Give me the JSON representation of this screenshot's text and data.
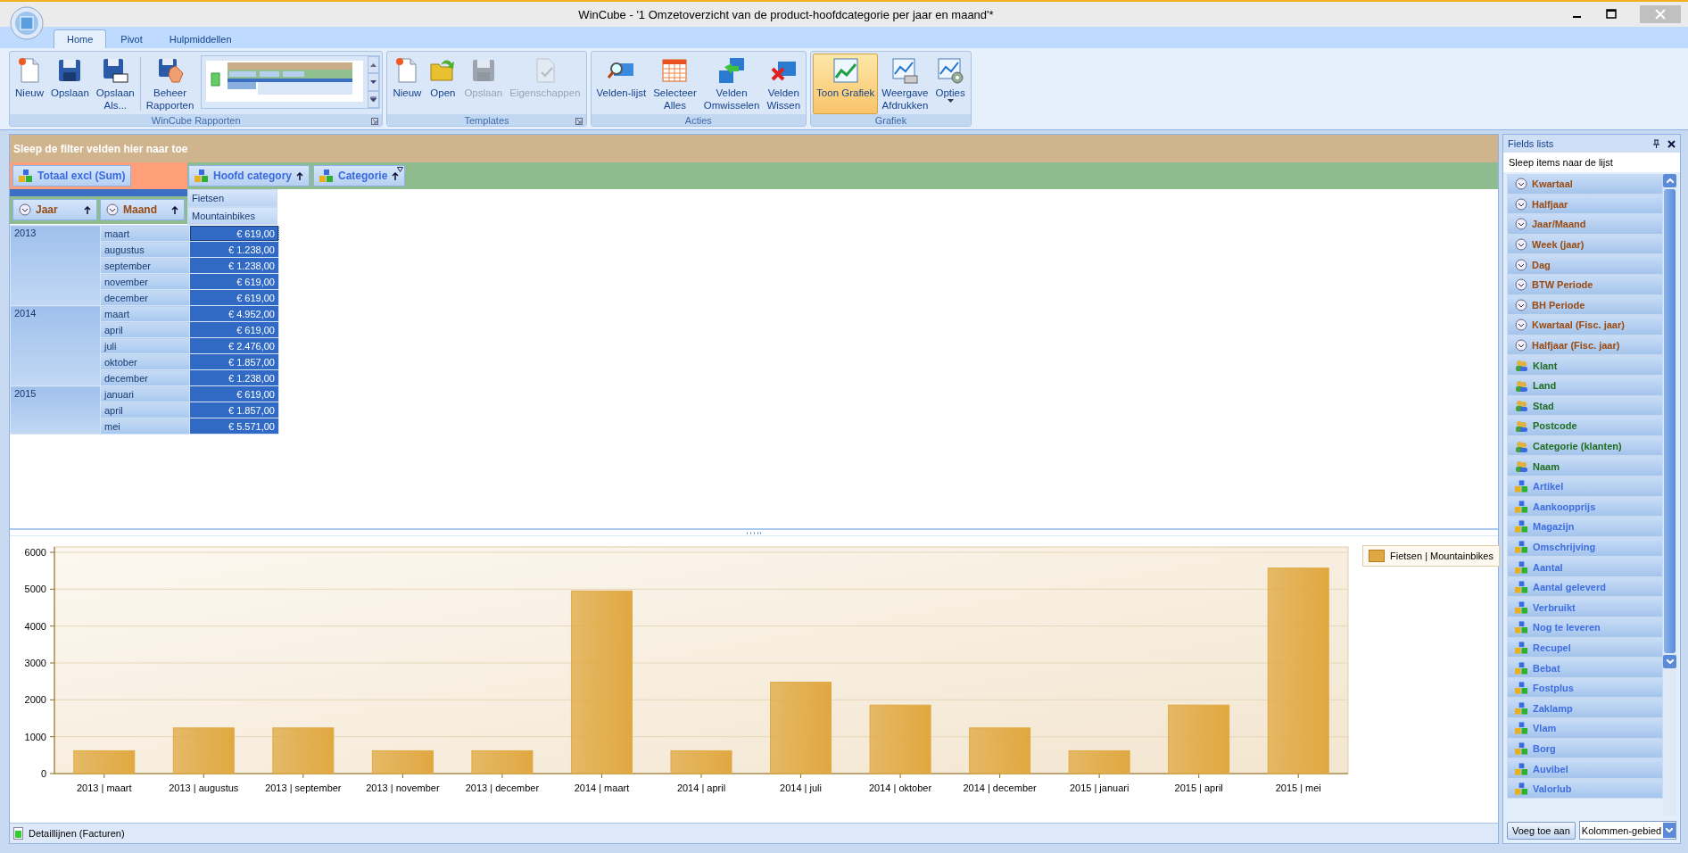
{
  "window": {
    "title": "WinCube - '1 Omzetoverzicht van de product-hoofdcategorie per jaar en maand'*"
  },
  "tabs": [
    {
      "label": "Home",
      "selected": true
    },
    {
      "label": "Pivot",
      "selected": false
    },
    {
      "label": "Hulpmiddellen",
      "selected": false
    }
  ],
  "ribbon_groups": [
    {
      "title": "WinCube Rapporten",
      "launcher": true,
      "buttons": [
        {
          "label": "Nieuw",
          "disabled": false,
          "selected": false
        },
        {
          "label": "Opslaan",
          "disabled": false,
          "selected": false
        },
        {
          "label": "Opslaan\nAls...",
          "disabled": false,
          "selected": false
        },
        {
          "label": "Beheer\nRapporten",
          "disabled": false,
          "selected": false
        }
      ]
    },
    {
      "title": "Templates",
      "launcher": true,
      "buttons": [
        {
          "label": "Nieuw",
          "disabled": false,
          "selected": false
        },
        {
          "label": "Open",
          "disabled": false,
          "selected": false
        },
        {
          "label": "Opslaan",
          "disabled": true,
          "selected": false
        },
        {
          "label": "Eigenschappen",
          "disabled": true,
          "selected": false
        }
      ]
    },
    {
      "title": "Acties",
      "launcher": false,
      "buttons": [
        {
          "label": "Velden-lijst",
          "disabled": false,
          "selected": false
        },
        {
          "label": "Selecteer\nAlles",
          "disabled": false,
          "selected": false
        },
        {
          "label": "Velden\nOmwisselen",
          "disabled": false,
          "selected": false
        },
        {
          "label": "Velden\nWissen",
          "disabled": false,
          "selected": false
        }
      ]
    },
    {
      "title": "Grafiek",
      "launcher": false,
      "buttons": [
        {
          "label": "Toon Grafiek",
          "disabled": false,
          "selected": true
        },
        {
          "label": "Weergave\nAfdrukken",
          "disabled": false,
          "selected": false
        },
        {
          "label": "Opties",
          "disabled": false,
          "selected": false
        }
      ]
    }
  ],
  "pivot": {
    "filter_area": "Sleep de filter velden hier naar toe",
    "data_fields": [
      {
        "label": "Totaal excl (Sum)"
      }
    ],
    "column_fields": [
      {
        "label": "Hoofd category",
        "filter": false
      },
      {
        "label": "Categorie",
        "filter": true
      }
    ],
    "row_fields": [
      {
        "label": "Jaar"
      },
      {
        "label": "Maand"
      }
    ],
    "column_headers": [
      "Fietsen",
      "Mountainbikes"
    ],
    "rows": [
      {
        "year": "2013",
        "months": [
          {
            "month": "maart",
            "value": "€ 619,00",
            "selected": true,
            "focused": true
          },
          {
            "month": "augustus",
            "value": "€ 1.238,00",
            "selected": true,
            "focused": false
          },
          {
            "month": "september",
            "value": "€ 1.238,00",
            "selected": true,
            "focused": false
          },
          {
            "month": "november",
            "value": "€ 619,00",
            "selected": true,
            "focused": false
          },
          {
            "month": "december",
            "value": "€ 619,00",
            "selected": true,
            "focused": false
          }
        ]
      },
      {
        "year": "2014",
        "months": [
          {
            "month": "maart",
            "value": "€ 4.952,00",
            "selected": true,
            "focused": false
          },
          {
            "month": "april",
            "value": "€ 619,00",
            "selected": true,
            "focused": false
          },
          {
            "month": "juli",
            "value": "€ 2.476,00",
            "selected": true,
            "focused": false
          },
          {
            "month": "oktober",
            "value": "€ 1.857,00",
            "selected": true,
            "focused": false
          },
          {
            "month": "december",
            "value": "€ 1.238,00",
            "selected": true,
            "focused": false
          }
        ]
      },
      {
        "year": "2015",
        "months": [
          {
            "month": "januari",
            "value": "€ 619,00",
            "selected": true,
            "focused": false
          },
          {
            "month": "april",
            "value": "€ 1.857,00",
            "selected": true,
            "focused": false
          },
          {
            "month": "mei",
            "value": "€ 5.571,00",
            "selected": true,
            "focused": false
          }
        ]
      }
    ]
  },
  "chart": {
    "chart_data": {
      "type": "bar",
      "categories": [
        "2013 | maart",
        "2013 | augustus",
        "2013 | september",
        "2013 | november",
        "2013 | december",
        "2014 | maart",
        "2014 | april",
        "2014 | juli",
        "2014 | oktober",
        "2014 | december",
        "2015 | januari",
        "2015 | april",
        "2015 | mei"
      ],
      "series": [
        {
          "name": "Fietsen | Mountainbikes",
          "color": "#e0a840",
          "values": [
            619,
            1238,
            1238,
            619,
            619,
            4952,
            619,
            2476,
            1857,
            1238,
            619,
            1857,
            5571
          ]
        }
      ],
      "ylim": [
        0,
        6000
      ],
      "yticks": [
        0,
        1000,
        2000,
        3000,
        4000,
        5000,
        6000
      ],
      "grid": true
    }
  },
  "status_bar": {
    "label": "Detaillijnen (Facturen)"
  },
  "fields_panel": {
    "title": "Fields lists",
    "hint": "Sleep items naar de lijst",
    "items": [
      {
        "label": "Kwartaal",
        "kind": "date"
      },
      {
        "label": "Halfjaar",
        "kind": "date"
      },
      {
        "label": "Jaar/Maand",
        "kind": "date"
      },
      {
        "label": "Week (jaar)",
        "kind": "date"
      },
      {
        "label": "Dag",
        "kind": "date"
      },
      {
        "label": "BTW Periode",
        "kind": "date"
      },
      {
        "label": "BH Periode",
        "kind": "date"
      },
      {
        "label": "Kwartaal (Fisc. jaar)",
        "kind": "date"
      },
      {
        "label": "Halfjaar (Fisc. jaar)",
        "kind": "date"
      },
      {
        "label": "Klant",
        "kind": "customer"
      },
      {
        "label": "Land",
        "kind": "customer"
      },
      {
        "label": "Stad",
        "kind": "customer"
      },
      {
        "label": "Postcode",
        "kind": "customer"
      },
      {
        "label": "Categorie (klanten)",
        "kind": "customer"
      },
      {
        "label": "Naam",
        "kind": "customer"
      },
      {
        "label": "Artikel",
        "kind": "product"
      },
      {
        "label": "Aankoopprijs",
        "kind": "product"
      },
      {
        "label": "Magazijn",
        "kind": "product"
      },
      {
        "label": "Omschrijving",
        "kind": "product"
      },
      {
        "label": "Aantal",
        "kind": "product"
      },
      {
        "label": "Aantal geleverd",
        "kind": "product"
      },
      {
        "label": "Verbruikt",
        "kind": "product"
      },
      {
        "label": "Nog te leveren",
        "kind": "product"
      },
      {
        "label": "Recupel",
        "kind": "product"
      },
      {
        "label": "Bebat",
        "kind": "product"
      },
      {
        "label": "Fostplus",
        "kind": "product"
      },
      {
        "label": "Zaklamp",
        "kind": "product"
      },
      {
        "label": "Vlam",
        "kind": "product"
      },
      {
        "label": "Borg",
        "kind": "product"
      },
      {
        "label": "Auvibel",
        "kind": "product"
      },
      {
        "label": "Valorlub",
        "kind": "product"
      }
    ],
    "add_button": "Voeg toe aan",
    "target": "Kolommen-gebied"
  }
}
